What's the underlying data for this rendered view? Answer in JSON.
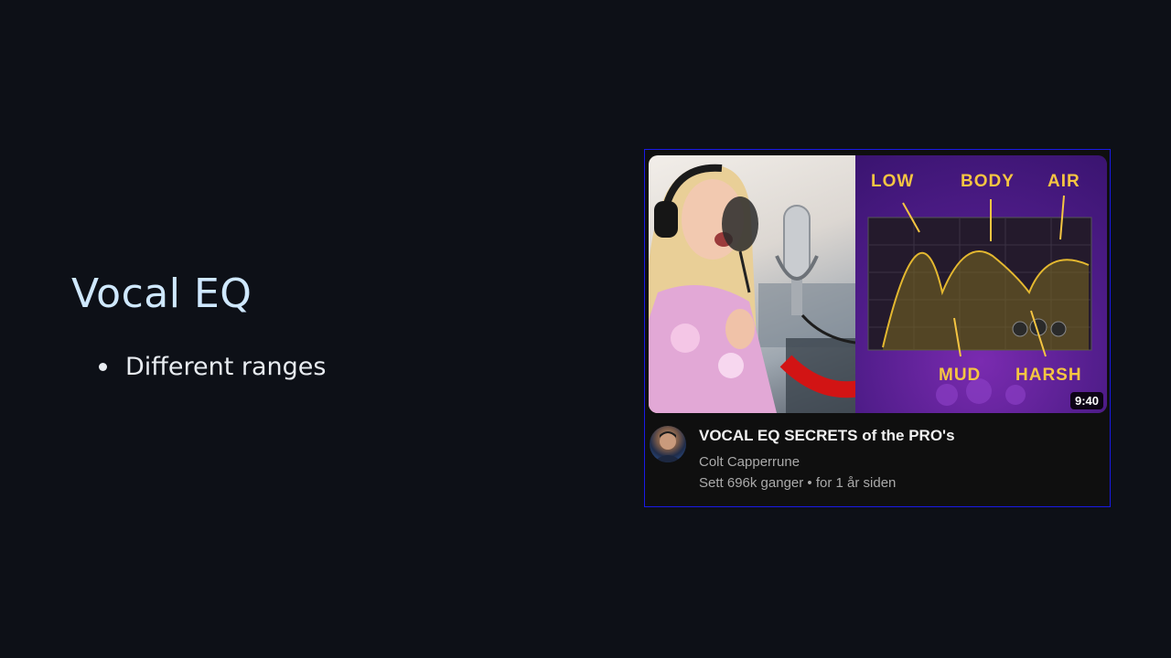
{
  "slide": {
    "title": "Vocal EQ",
    "bullets": [
      "Different ranges"
    ]
  },
  "video": {
    "title": "VOCAL EQ SECRETS of the PRO's",
    "channel": "Colt Capperrune",
    "meta": "Sett 696k ganger • for 1 år siden",
    "duration": "9:40",
    "thumbnail_labels": {
      "low": "LOW",
      "body": "BODY",
      "air": "AIR",
      "mud": "MUD",
      "harsh": "HARSH"
    }
  },
  "colors": {
    "background": "#0d1017",
    "title": "#cfe8ff",
    "card_border": "#1a1ae6",
    "thumb_label": "#f5c542"
  }
}
